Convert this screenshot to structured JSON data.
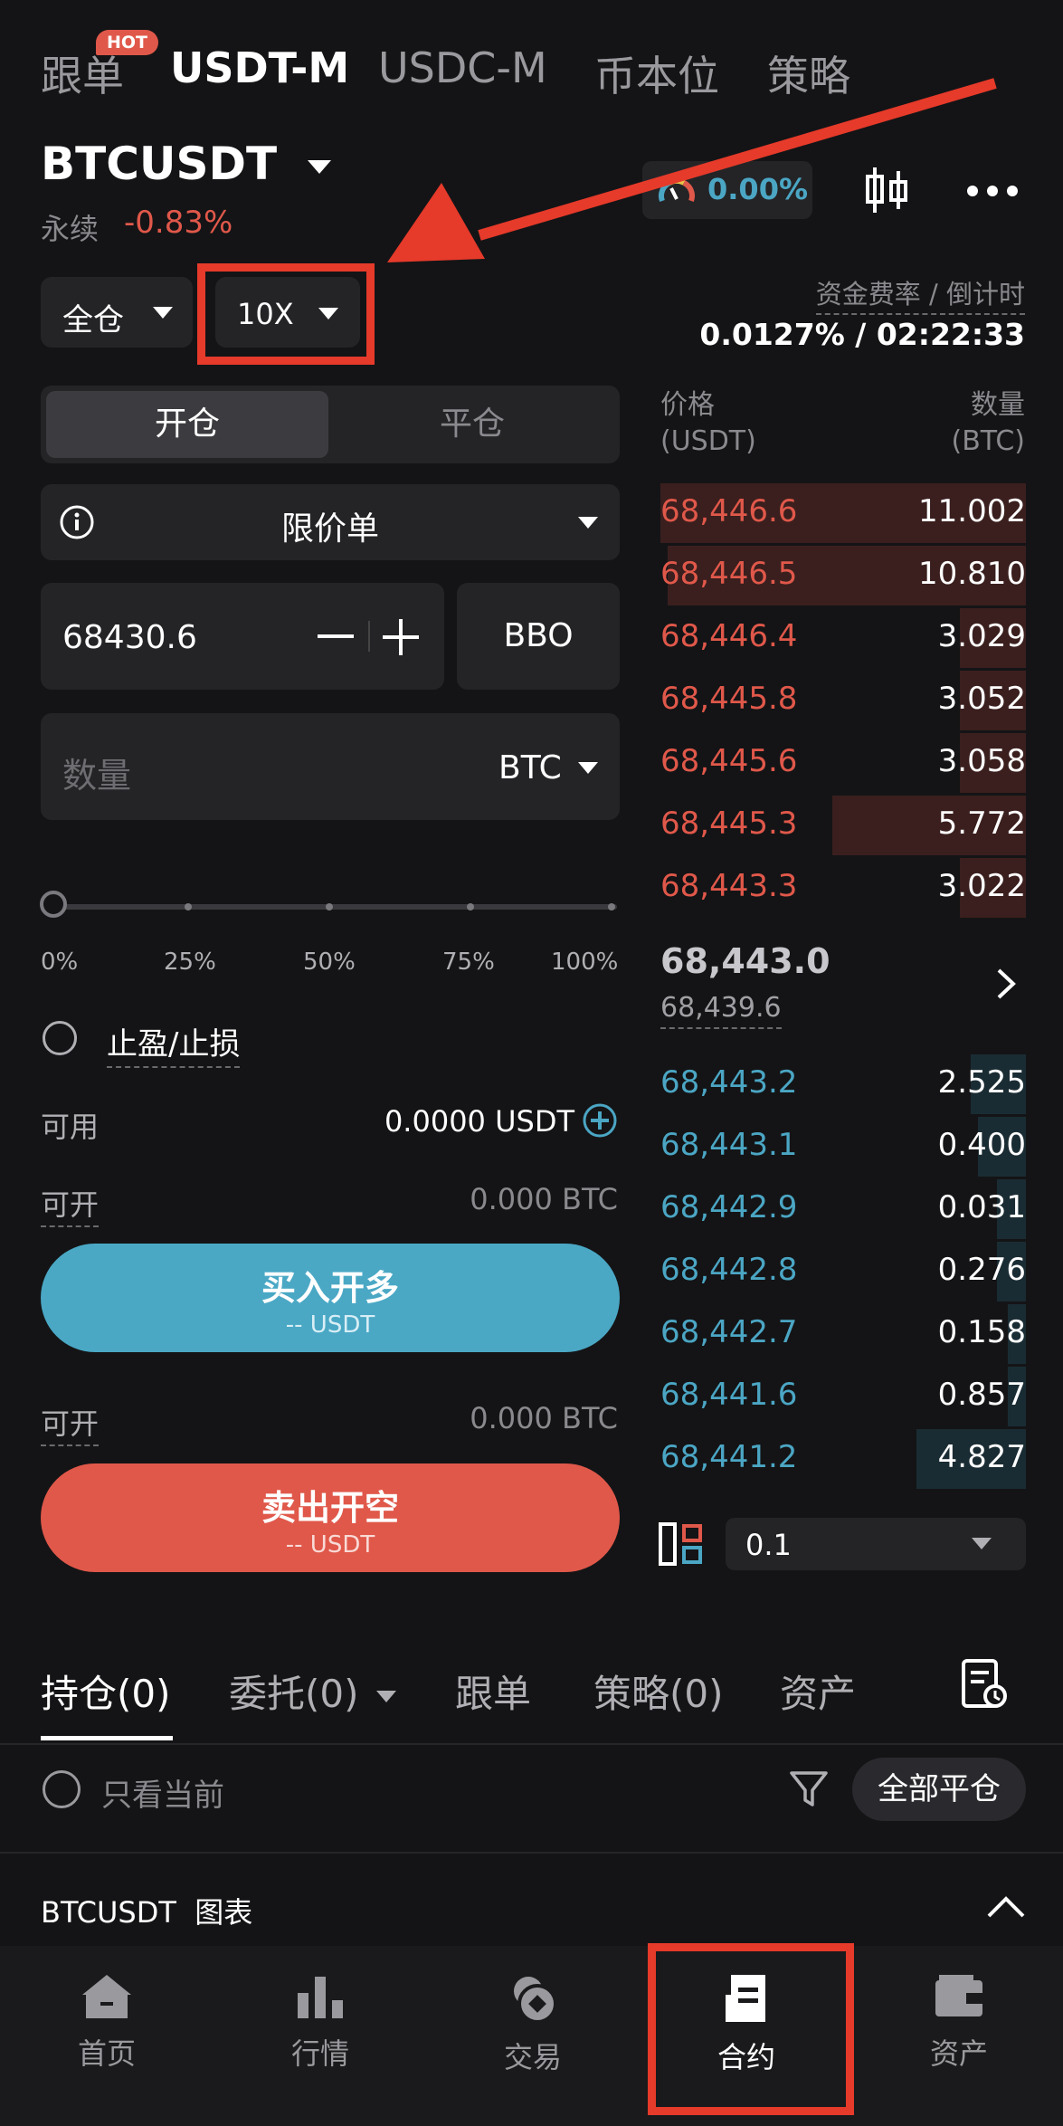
{
  "top_tabs": [
    {
      "label": "跟单",
      "badge": "HOT"
    },
    {
      "label": "USDT-M"
    },
    {
      "label": "USDC-M"
    },
    {
      "label": "币本位"
    },
    {
      "label": "策略"
    }
  ],
  "symbol": {
    "name": "BTCUSDT",
    "type": "永续",
    "change": "-0.83%",
    "sentiment": "0.00%"
  },
  "margin_mode": "全仓",
  "leverage": "10X",
  "funding": {
    "label": "资金费率 / 倒计时",
    "value": "0.0127% / 02:22:33"
  },
  "order_side_tabs": {
    "open": "开仓",
    "close": "平仓"
  },
  "order_type": "限价单",
  "price_input": {
    "value": "68430.6",
    "bbo": "BBO"
  },
  "qty_input": {
    "placeholder": "数量",
    "unit": "BTC"
  },
  "slider": {
    "value_fraction": 0,
    "marks": [
      "0%",
      "25%",
      "50%",
      "75%",
      "100%"
    ]
  },
  "tpsl_label": "止盈/止损",
  "available": {
    "label": "可用",
    "value": "0.0000 USDT"
  },
  "openable_long": {
    "label": "可开",
    "value": "0.000 BTC"
  },
  "openable_short": {
    "label": "可开",
    "value": "0.000 BTC"
  },
  "buy_button": {
    "label": "买入开多",
    "sub": "-- USDT"
  },
  "sell_button": {
    "label": "卖出开空",
    "sub": "-- USDT"
  },
  "orderbook": {
    "price_header": "价格",
    "price_unit": "(USDT)",
    "qty_header": "数量",
    "qty_unit": "(BTC)",
    "asks": [
      {
        "price": "68,446.6",
        "qty": "11.002",
        "depth": 1.0
      },
      {
        "price": "68,446.5",
        "qty": "10.810",
        "depth": 0.98
      },
      {
        "price": "68,446.4",
        "qty": "3.029",
        "depth": 0.18
      },
      {
        "price": "68,445.8",
        "qty": "3.052",
        "depth": 0.18
      },
      {
        "price": "68,445.6",
        "qty": "3.058",
        "depth": 0.18
      },
      {
        "price": "68,445.3",
        "qty": "5.772",
        "depth": 0.53
      },
      {
        "price": "68,443.3",
        "qty": "3.022",
        "depth": 0.18
      }
    ],
    "last_price": "68,443.0",
    "mark_price": "68,439.6",
    "bids": [
      {
        "price": "68,443.2",
        "qty": "2.525",
        "depth": 0.15
      },
      {
        "price": "68,443.1",
        "qty": "0.400",
        "depth": 0.13
      },
      {
        "price": "68,442.9",
        "qty": "0.031",
        "depth": 0.08
      },
      {
        "price": "68,442.8",
        "qty": "0.276",
        "depth": 0.08
      },
      {
        "price": "68,442.7",
        "qty": "0.158",
        "depth": 0.05
      },
      {
        "price": "68,441.6",
        "qty": "0.857",
        "depth": 0.05
      },
      {
        "price": "68,441.2",
        "qty": "4.827",
        "depth": 0.3
      }
    ],
    "precision": "0.1"
  },
  "bottom_tabs": [
    "持仓(0)",
    "委托(0)",
    "跟单",
    "策略(0)",
    "资产"
  ],
  "only_current": "只看当前",
  "close_all": "全部平仓",
  "chart_link": {
    "symbol": "BTCUSDT",
    "label": "图表"
  },
  "nav": [
    {
      "label": "首页",
      "icon": "home-icon"
    },
    {
      "label": "行情",
      "icon": "market-icon"
    },
    {
      "label": "交易",
      "icon": "trade-icon"
    },
    {
      "label": "合约",
      "icon": "futures-icon"
    },
    {
      "label": "资产",
      "icon": "wallet-icon"
    }
  ],
  "colors": {
    "ask": "#e0584a",
    "bid": "#4ba6c4",
    "buy": "#4aa8c5",
    "sell": "#e0584a",
    "annotation": "#e63a2a"
  }
}
